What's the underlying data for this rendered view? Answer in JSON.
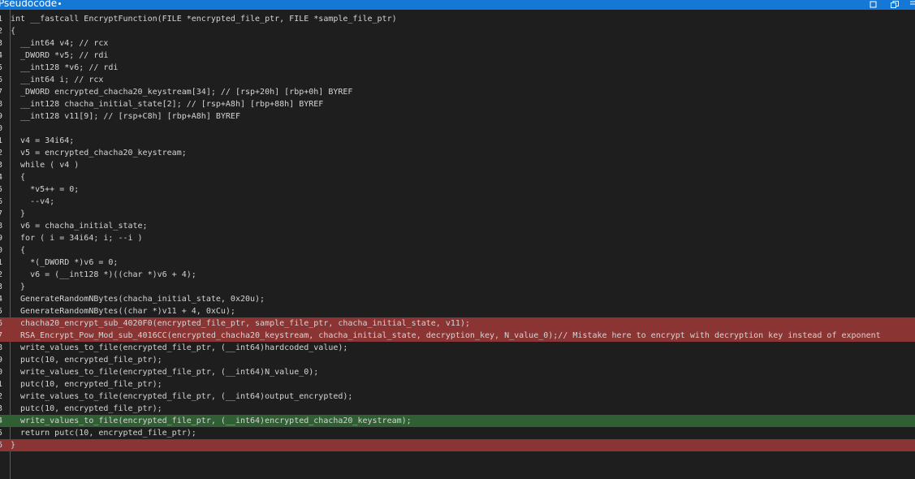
{
  "window": {
    "title": "Pseudocode"
  },
  "code": {
    "lines": [
      {
        "n": "1",
        "t": "int __fastcall EncryptFunction(FILE *encrypted_file_ptr, FILE *sample_file_ptr)"
      },
      {
        "n": "2",
        "t": "{"
      },
      {
        "n": "3",
        "t": "  __int64 v4; // rcx"
      },
      {
        "n": "4",
        "t": "  _DWORD *v5; // rdi"
      },
      {
        "n": "5",
        "t": "  __int128 *v6; // rdi"
      },
      {
        "n": "6",
        "t": "  __int64 i; // rcx"
      },
      {
        "n": "7",
        "t": "  _DWORD encrypted_chacha20_keystream[34]; // [rsp+20h] [rbp+0h] BYREF"
      },
      {
        "n": "8",
        "t": "  __int128 chacha_initial_state[2]; // [rsp+A8h] [rbp+88h] BYREF"
      },
      {
        "n": "9",
        "t": "  __int128 v11[9]; // [rsp+C8h] [rbp+A8h] BYREF"
      },
      {
        "n": "0",
        "t": ""
      },
      {
        "n": "1",
        "t": "  v4 = 34i64;"
      },
      {
        "n": "2",
        "t": "  v5 = encrypted_chacha20_keystream;"
      },
      {
        "n": "3",
        "t": "  while ( v4 )"
      },
      {
        "n": "4",
        "t": "  {"
      },
      {
        "n": "5",
        "t": "    *v5++ = 0;"
      },
      {
        "n": "6",
        "t": "    --v4;"
      },
      {
        "n": "7",
        "t": "  }"
      },
      {
        "n": "8",
        "t": "  v6 = chacha_initial_state;"
      },
      {
        "n": "9",
        "t": "  for ( i = 34i64; i; --i )"
      },
      {
        "n": "0",
        "t": "  {"
      },
      {
        "n": "1",
        "t": "    *(_DWORD *)v6 = 0;"
      },
      {
        "n": "2",
        "t": "    v6 = (__int128 *)((char *)v6 + 4);"
      },
      {
        "n": "3",
        "t": "  }"
      },
      {
        "n": "4",
        "t": "  GenerateRandomNBytes(chacha_initial_state, 0x20u);"
      },
      {
        "n": "5",
        "t": "  GenerateRandomNBytes((char *)v11 + 4, 0xCu);"
      },
      {
        "n": "6",
        "t": "  chacha20_encrypt_sub_4020F0(encrypted_file_ptr, sample_file_ptr, chacha_initial_state, v11);"
      },
      {
        "n": "7",
        "t": "  RSA_Encrypt_Pow_Mod_sub_4016CC(encrypted_chacha20_keystream, chacha_initial_state, decryption_key, N_value_0);// Mistake here to encrypt with decryption key instead of exponent"
      },
      {
        "n": "8",
        "t": "  write_values_to_file(encrypted_file_ptr, (__int64)hardcoded_value);"
      },
      {
        "n": "9",
        "t": "  putc(10, encrypted_file_ptr);"
      },
      {
        "n": "0",
        "t": "  write_values_to_file(encrypted_file_ptr, (__int64)N_value_0);"
      },
      {
        "n": "1",
        "t": "  putc(10, encrypted_file_ptr);"
      },
      {
        "n": "2",
        "t": "  write_values_to_file(encrypted_file_ptr, (__int64)output_encrypted);"
      },
      {
        "n": "3",
        "t": "  putc(10, encrypted_file_ptr);"
      },
      {
        "n": "4",
        "t": "  write_values_to_file(encrypted_file_ptr, (__int64)encrypted_chacha20_keystream);"
      },
      {
        "n": "5",
        "t": "  return putc(10, encrypted_file_ptr);"
      },
      {
        "n": "6",
        "t": "}"
      }
    ],
    "highlight": {
      "red_lines": [
        25,
        26,
        35
      ],
      "green_lines": [
        33
      ]
    }
  },
  "colors": {
    "titlebar": "#1577d6",
    "background": "#1e1e1e",
    "keyword": "#4fa0e8",
    "highlight_red": "#8b3434",
    "highlight_green": "#2f5f33",
    "selection": "#264f78"
  },
  "icons": [
    "restore-window-icon",
    "maximize-window-icon",
    "float-window-icon"
  ]
}
